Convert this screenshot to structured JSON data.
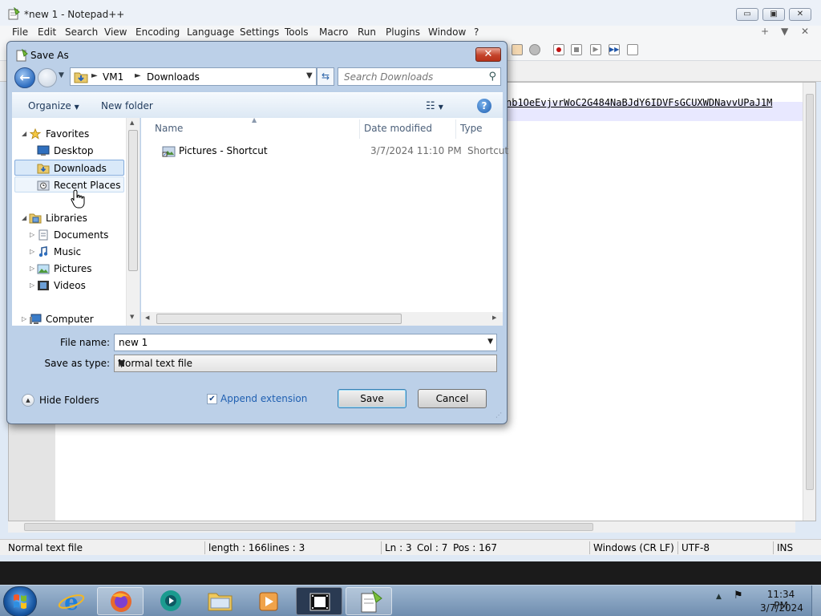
{
  "npp": {
    "title": "*new 1 - Notepad++",
    "menu": [
      "File",
      "Edit",
      "Search",
      "View",
      "Encoding",
      "Language",
      "Settings",
      "Tools",
      "Macro",
      "Run",
      "Plugins",
      "Window",
      "?"
    ],
    "menu_right": [
      "+",
      "▼",
      "✕"
    ],
    "window_buttons": {
      "minimize": "▭",
      "maximize": "▣",
      "close": "✕"
    },
    "editor_text": "nb1OeEvjvrWoC2G484NaBJdY6IDVFsGCUXWDNavvUPaJ1M",
    "status": {
      "type": "Normal text file",
      "length": "length : 166",
      "lines": "lines : 3",
      "ln": "Ln : 3",
      "col": "Col : 7",
      "pos": "Pos : 167",
      "eol": "Windows (CR LF)",
      "encoding": "UTF-8",
      "mode": "INS"
    }
  },
  "dialog": {
    "title": "Save As",
    "close_label": "✕",
    "breadcrumb": [
      "VM1",
      "Downloads"
    ],
    "search_placeholder": "Search Downloads",
    "organize_label": "Organize",
    "new_folder_label": "New folder",
    "help_label": "?",
    "nav": {
      "favorites": "Favorites",
      "desktop": "Desktop",
      "downloads": "Downloads",
      "recent": "Recent Places",
      "libraries": "Libraries",
      "documents": "Documents",
      "music": "Music",
      "pictures": "Pictures",
      "videos": "Videos",
      "computer": "Computer"
    },
    "columns": {
      "name": "Name",
      "date": "Date modified",
      "type": "Type"
    },
    "file": {
      "name": "Pictures - Shortcut",
      "date": "3/7/2024 11:10 PM",
      "type": "Shortcut"
    },
    "file_name_label": "File name:",
    "file_name_value": "new 1",
    "save_type_label": "Save as type:",
    "save_type_value": "Normal text file",
    "hide_folders_label": "Hide Folders",
    "append_extension_label": "Append extension",
    "append_extension_checked": true,
    "save_label": "Save",
    "cancel_label": "Cancel"
  },
  "taskbar": {
    "clock_time": "11:34 PM",
    "clock_date": "3/7/2024"
  }
}
